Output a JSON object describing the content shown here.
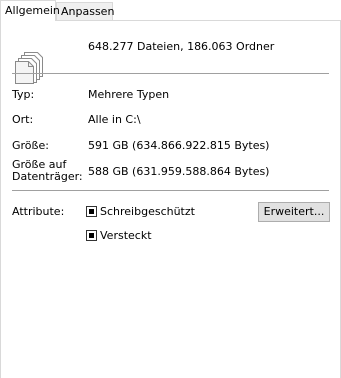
{
  "tabs": [
    {
      "label": "Allgemein",
      "active": true
    },
    {
      "label": "Anpassen",
      "active": false
    }
  ],
  "summary": "648.277 Dateien, 186.063 Ordner",
  "properties": {
    "type_label": "Typ:",
    "type_value": "Mehrere Typen",
    "location_label": "Ort:",
    "location_value": "Alle in C:\\",
    "size_label": "Größe:",
    "size_value": "591 GB (634.866.922.815 Bytes)",
    "size_on_disk_label_line1": "Größe auf",
    "size_on_disk_label_line2": "Datenträger:",
    "size_on_disk_value": "588 GB (631.959.588.864 Bytes)"
  },
  "attributes": {
    "label": "Attribute:",
    "readonly_label": "Schreibgeschützt",
    "readonly_state": "indeterminate",
    "hidden_label": "Versteckt",
    "hidden_state": "indeterminate",
    "advanced_button": "Erweitert..."
  },
  "icons": {
    "files": "multiple-files-icon"
  },
  "colors": {
    "separator": "#a0a0a0",
    "button_face": "#e1e1e1",
    "tab_border": "#d9d9d9"
  }
}
